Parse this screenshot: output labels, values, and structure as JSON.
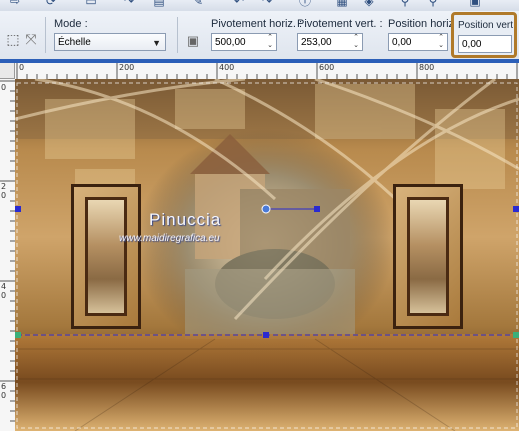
{
  "toolbar": {
    "mode_label": "Mode :",
    "mode_value": "Échelle",
    "pivot_h_label": "Pivotement horiz. :",
    "pivot_h_value": "500,00",
    "pivot_v_label": "Pivotement vert. :",
    "pivot_v_value": "253,00",
    "pos_h_label": "Position horiz. :",
    "pos_h_value": "0,00",
    "pos_v_label": "Position vert",
    "pos_v_value": "0,00"
  },
  "rulers": {
    "horizontal_ticks": [
      "0",
      "200",
      "400",
      "600",
      "800"
    ],
    "vertical_ticks": [
      "0",
      "2",
      "0",
      "4",
      "0",
      "6",
      "0"
    ]
  },
  "canvas": {
    "watermark_name": "Pinuccia",
    "watermark_url": "www.maidiregrafica.eu"
  },
  "colors": {
    "toolbar_bg": "#e3e8f0",
    "accent_blue": "#2c5fb8",
    "selected_field_border": "#b07a2a",
    "image_gold": "#b07a36",
    "frame_dark": "#3b220f"
  },
  "icons": [
    "save-icon",
    "undo-icon",
    "redo-icon",
    "help-icon",
    "zoom-icon"
  ]
}
